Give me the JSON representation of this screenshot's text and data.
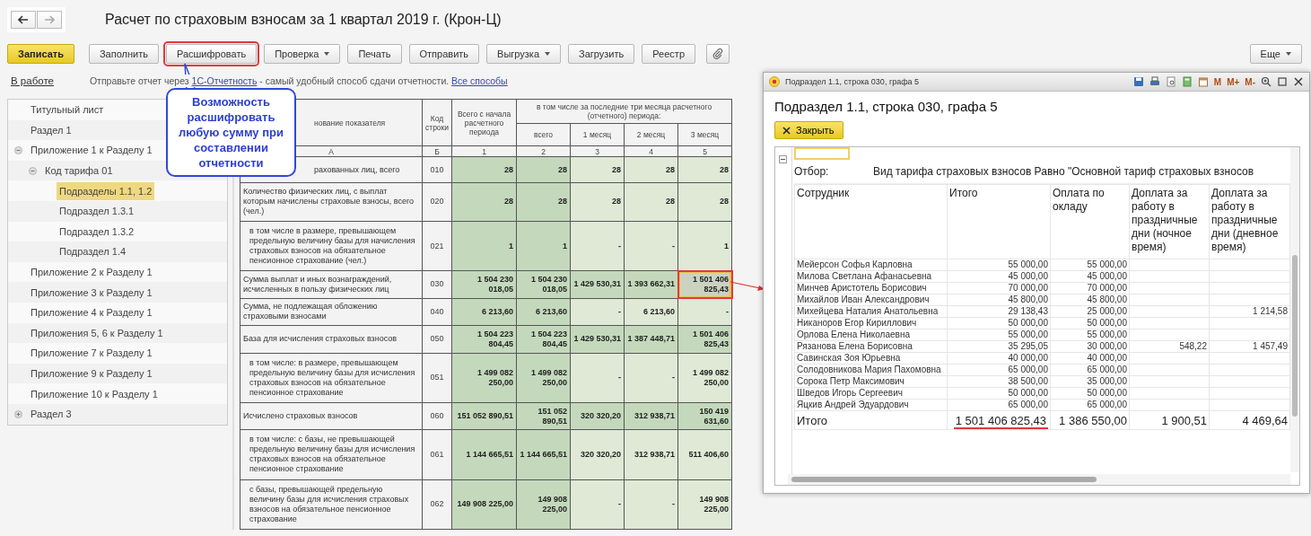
{
  "title": "Расчет по страховым взносам за 1 квартал 2019 г. (Крон-Ц)",
  "toolbar": [
    {
      "kind": "text",
      "label": "Записать",
      "primary": true,
      "highlighted": false,
      "dropdown": false
    },
    {
      "kind": "text",
      "label": "Заполнить",
      "primary": false,
      "highlighted": false,
      "dropdown": false
    },
    {
      "kind": "text",
      "label": "Расшифровать",
      "primary": false,
      "highlighted": true,
      "dropdown": false
    },
    {
      "kind": "text",
      "label": "Проверка",
      "primary": false,
      "highlighted": false,
      "dropdown": true
    },
    {
      "kind": "text",
      "label": "Печать",
      "primary": false,
      "highlighted": false,
      "dropdown": false
    },
    {
      "kind": "text",
      "label": "Отправить",
      "primary": false,
      "highlighted": false,
      "dropdown": false
    },
    {
      "kind": "text",
      "label": "Выгрузка",
      "primary": false,
      "highlighted": false,
      "dropdown": true
    },
    {
      "kind": "text",
      "label": "Загрузить",
      "primary": false,
      "highlighted": false,
      "dropdown": false
    },
    {
      "kind": "text",
      "label": "Реестр",
      "primary": false,
      "highlighted": false,
      "dropdown": false
    },
    {
      "kind": "icon",
      "primary": false,
      "highlighted": false,
      "dropdown": false
    }
  ],
  "more_button": "Еще",
  "info": {
    "status": "В работе",
    "before": "Отправьте отчет через",
    "link": "1С-Отчетность",
    "after": "- самый удобный способ сдачи отчетности.",
    "link2": "Все способы"
  },
  "callout": "Возможность расшифровать любую сумму при составлении отчетности",
  "sidebar": {
    "items": [
      {
        "label": "Титульный лист",
        "selected": false
      },
      {
        "label": "Раздел 1",
        "selected": false
      },
      {
        "label": "Приложение 1 к Разделу 1",
        "selected": false,
        "expanded": true,
        "children": [
          {
            "label": "Код тарифа 01",
            "selected": false,
            "expanded": true,
            "children": [
              {
                "label": "Подразделы 1.1, 1.2",
                "selected": true
              },
              {
                "label": "Подраздел 1.3.1",
                "selected": false
              },
              {
                "label": "Подраздел 1.3.2",
                "selected": false
              },
              {
                "label": "Подраздел 1.4",
                "selected": false
              }
            ]
          }
        ]
      },
      {
        "label": "Приложение 2 к Разделу 1",
        "selected": false
      },
      {
        "label": "Приложение 3 к Разделу 1",
        "selected": false
      },
      {
        "label": "Приложение 4 к Разделу 1",
        "selected": false
      },
      {
        "label": "Приложения 5, 6 к Разделу 1",
        "selected": false
      },
      {
        "label": "Приложение 7 к Разделу 1",
        "selected": false
      },
      {
        "label": "Приложение 9 к Разделу 1",
        "selected": false
      },
      {
        "label": "Приложение 10 к Разделу 1",
        "selected": false
      },
      {
        "label": "Раздел 3",
        "selected": false,
        "expanded": false
      }
    ]
  },
  "form": {
    "headers": {
      "label": "нование показателя",
      "code": "Код строки",
      "total": "Всего с начала расчетного периода",
      "group": "в том числе за последние три месяца расчетного (отчетного) периода:",
      "months": [
        "всего",
        "1 месяц",
        "2 месяц",
        "3 месяц"
      ]
    },
    "column_numbers": [
      "А",
      "Б",
      "1",
      "2",
      "3",
      "4",
      "5"
    ],
    "rows": [
      {
        "kind": "partial",
        "label": "рахованных лиц, всего",
        "code": "010",
        "highlighted": false,
        "cells": [
          {
            "text": "28",
            "selected": false
          },
          {
            "text": "28",
            "selected": false
          },
          {
            "text": "28",
            "selected": false
          },
          {
            "text": "28",
            "selected": false
          },
          {
            "text": "28",
            "selected": false
          }
        ]
      },
      {
        "kind": "main",
        "label": "Количество физических лиц, с выплат которым начислены страховые взносы, всего (чел.)",
        "code": "020",
        "highlighted": false,
        "cells": [
          {
            "text": "28",
            "selected": false
          },
          {
            "text": "28",
            "selected": false
          },
          {
            "text": "28",
            "selected": false
          },
          {
            "text": "28",
            "selected": false
          },
          {
            "text": "28",
            "selected": false
          }
        ]
      },
      {
        "kind": "sub",
        "label": "в том числе в размере, превышающем предельную величину базы для начисления страховых взносов на обязательное пенсионное страхование (чел.)",
        "code": "021",
        "highlighted": false,
        "cells": [
          {
            "text": "1",
            "selected": false
          },
          {
            "text": "1",
            "selected": false
          },
          {
            "text": "-",
            "selected": false
          },
          {
            "text": "-",
            "selected": false
          },
          {
            "text": "1",
            "selected": false
          }
        ]
      },
      {
        "kind": "main",
        "label": "Сумма выплат и иных вознаграждений, исчисленных в пользу физических лиц",
        "code": "030",
        "highlighted": true,
        "cells": [
          {
            "text": "1 504 230 018,05",
            "selected": false
          },
          {
            "text": "1 504 230 018,05",
            "selected": false
          },
          {
            "text": "1 429 530,31",
            "selected": false
          },
          {
            "text": "1 393 662,31",
            "selected": false
          },
          {
            "text": "1 501 406 825,43",
            "selected": true
          }
        ]
      },
      {
        "kind": "main",
        "label": "Сумма, не подлежащая обложению страховыми взносами",
        "code": "040",
        "highlighted": false,
        "cells": [
          {
            "text": "6 213,60",
            "selected": false
          },
          {
            "text": "6 213,60",
            "selected": false
          },
          {
            "text": "-",
            "selected": false
          },
          {
            "text": "6 213,60",
            "selected": false
          },
          {
            "text": "-",
            "selected": false
          }
        ]
      },
      {
        "kind": "main",
        "label": "База для исчисления страховых взносов",
        "code": "050",
        "highlighted": true,
        "cells": [
          {
            "text": "1 504 223 804,45",
            "selected": false
          },
          {
            "text": "1 504 223 804,45",
            "selected": false
          },
          {
            "text": "1 429 530,31",
            "selected": false
          },
          {
            "text": "1 387 448,71",
            "selected": false
          },
          {
            "text": "1 501 406 825,43",
            "selected": false
          }
        ]
      },
      {
        "kind": "sub",
        "label": "в том числе: в размере, превышающем предельную величину базы для исчисления страховых взносов на обязательное пенсионное страхование",
        "code": "051",
        "highlighted": false,
        "cells": [
          {
            "text": "1 499 082 250,00",
            "selected": false
          },
          {
            "text": "1 499 082 250,00",
            "selected": false
          },
          {
            "text": "-",
            "selected": false
          },
          {
            "text": "-",
            "selected": false
          },
          {
            "text": "1 499 082 250,00",
            "selected": false
          }
        ]
      },
      {
        "kind": "main",
        "label": "Исчислено страховых взносов",
        "code": "060",
        "highlighted": true,
        "cells": [
          {
            "text": "151 052 890,51",
            "selected": false
          },
          {
            "text": "151 052 890,51",
            "selected": false
          },
          {
            "text": "320 320,20",
            "selected": false
          },
          {
            "text": "312 938,71",
            "selected": false
          },
          {
            "text": "150 419 631,60",
            "selected": false
          }
        ]
      },
      {
        "kind": "sub",
        "label": "в том числе: с базы, не превышающей предельную величину базы для исчисления страховых взносов на обязательное пенсионное страхование",
        "code": "061",
        "highlighted": false,
        "cells": [
          {
            "text": "1 144 665,51",
            "selected": false
          },
          {
            "text": "1 144 665,51",
            "selected": false
          },
          {
            "text": "320 320,20",
            "selected": false
          },
          {
            "text": "312 938,71",
            "selected": false
          },
          {
            "text": "511 406,60",
            "selected": false
          }
        ]
      },
      {
        "kind": "sub",
        "label": "с базы, превышающей предельную величину базы для исчисления страховых взносов на обязательное пенсионное страхование",
        "code": "062",
        "highlighted": false,
        "cells": [
          {
            "text": "149 908 225,00",
            "selected": false
          },
          {
            "text": "149 908 225,00",
            "selected": false
          },
          {
            "text": "-",
            "selected": false
          },
          {
            "text": "-",
            "selected": false
          },
          {
            "text": "149 908 225,00",
            "selected": false
          }
        ]
      }
    ]
  },
  "popup": {
    "window_title": "Подраздел 1.1, строка 030, графа 5",
    "memory_buttons": [
      "M",
      "M+",
      "M-"
    ],
    "heading": "Подраздел 1.1, строка 030, графа 5",
    "close_button": "Закрыть",
    "filter_label": "Отбор:",
    "filter": "Вид тарифа страховых взносов Равно \"Основной тариф страховых взносов",
    "columns": [
      "Сотрудник",
      "Итого",
      "Оплата по окладу",
      "Доплата за работу в праздничные дни (ночное время)",
      "Доплата за работу в праздничные дни (дневное время)"
    ],
    "rows": [
      {
        "name": "Мейерсон Софья Карловна",
        "total": "55 000,00",
        "salary": "55 000,00"
      },
      {
        "name": "Милова Светлана Афанасьевна",
        "total": "45 000,00",
        "salary": "45 000,00"
      },
      {
        "name": "Минчев Аристотель Борисович",
        "total": "70 000,00",
        "salary": "70 000,00"
      },
      {
        "name": "Михайлов Иван Александрович",
        "total": "45 800,00",
        "salary": "45 800,00"
      },
      {
        "name": "Михейцева Наталия Анатольевна",
        "total": "29 138,43",
        "salary": "25 000,00",
        "day": "1 214,58"
      },
      {
        "name": "Никаноров Егор Кириллович",
        "total": "50 000,00",
        "salary": "50 000,00"
      },
      {
        "name": "Орлова Елена Николаевна",
        "total": "55 000,00",
        "salary": "55 000,00"
      },
      {
        "name": "Рязанова Елена Борисовна",
        "total": "35 295,05",
        "salary": "30 000,00",
        "night": "548,22",
        "day": "1 457,49"
      },
      {
        "name": "Савинская Зоя Юрьевна",
        "total": "40 000,00",
        "salary": "40 000,00"
      },
      {
        "name": "Солодовникова Мария Пахомовна",
        "total": "65 000,00",
        "salary": "65 000,00"
      },
      {
        "name": "Сорока Петр Максимович",
        "total": "38 500,00",
        "salary": "35 000,00"
      },
      {
        "name": "Шведов Игорь Сергеевич",
        "total": "50 000,00",
        "salary": "50 000,00"
      },
      {
        "name": "Яцкив Андрей Эдуардович",
        "total": "65 000,00",
        "salary": "65 000,00"
      }
    ],
    "totals": [
      {
        "text": "Итого",
        "underlined": false
      },
      {
        "text": "1 501 406 825,43",
        "underlined": true
      },
      {
        "text": "1 386 550,00",
        "underlined": false
      },
      {
        "text": "1 900,51",
        "underlined": false
      },
      {
        "text": "4 469,64",
        "underlined": false
      }
    ]
  }
}
